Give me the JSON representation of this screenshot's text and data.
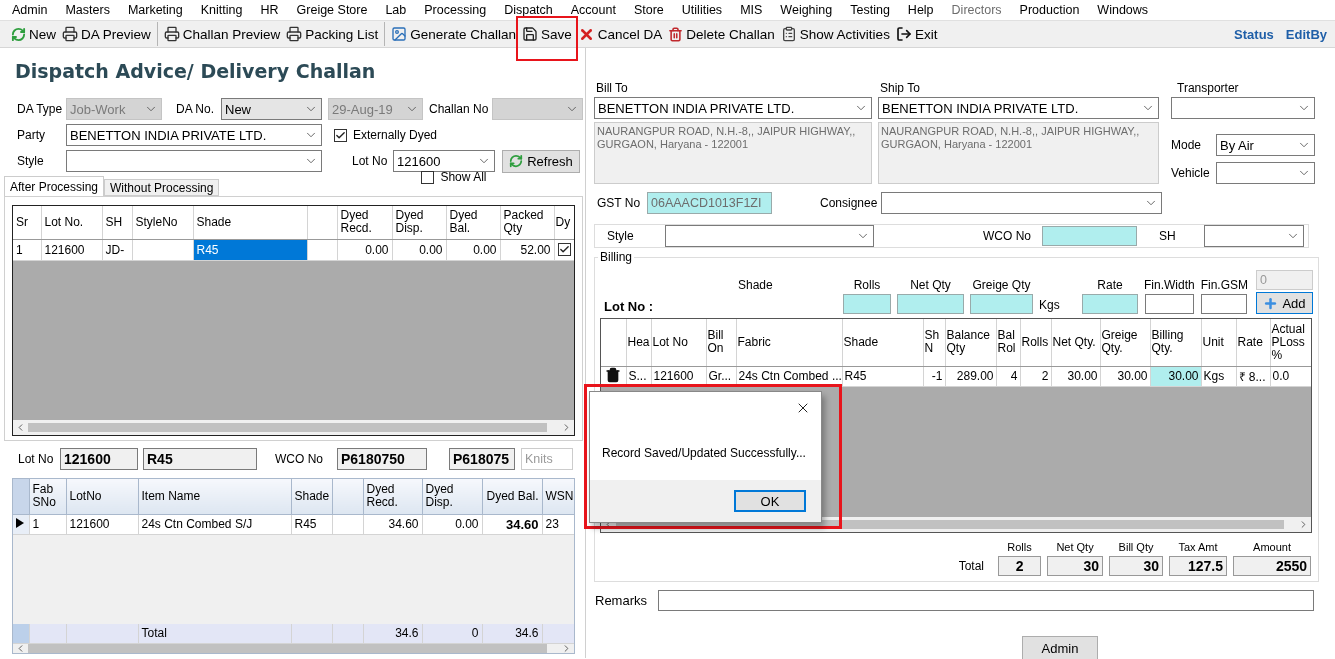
{
  "menu": [
    {
      "label": "Admin",
      "disabled": false
    },
    {
      "label": "Masters",
      "disabled": false
    },
    {
      "label": "Marketing",
      "disabled": false
    },
    {
      "label": "Knitting",
      "disabled": false
    },
    {
      "label": "HR",
      "disabled": false
    },
    {
      "label": "Greige Store",
      "disabled": false
    },
    {
      "label": "Lab",
      "disabled": false
    },
    {
      "label": "Processing",
      "disabled": false
    },
    {
      "label": "Dispatch",
      "disabled": false
    },
    {
      "label": "Account",
      "disabled": false
    },
    {
      "label": "Store",
      "disabled": false
    },
    {
      "label": "Utilities",
      "disabled": false
    },
    {
      "label": "MIS",
      "disabled": false
    },
    {
      "label": "Weighing",
      "disabled": false
    },
    {
      "label": "Testing",
      "disabled": false
    },
    {
      "label": "Help",
      "disabled": false
    },
    {
      "label": "Directors",
      "disabled": true
    },
    {
      "label": "Production",
      "disabled": false
    },
    {
      "label": "Windows",
      "disabled": false
    }
  ],
  "toolbar": {
    "groups": [
      [
        {
          "label": "New",
          "highlighted": false
        },
        {
          "label": "DA Preview",
          "highlighted": false
        }
      ],
      [
        {
          "label": "Challan Preview",
          "highlighted": false
        },
        {
          "label": "Packing List",
          "highlighted": false
        }
      ],
      [
        {
          "label": "Generate Challan",
          "highlighted": false
        },
        {
          "label": "Save",
          "highlighted": true
        },
        {
          "label": "Cancel DA",
          "highlighted": false
        },
        {
          "label": "Delete Challan",
          "highlighted": false
        },
        {
          "label": "Show Activities",
          "highlighted": false
        },
        {
          "label": "Exit",
          "highlighted": false
        }
      ]
    ],
    "links": [
      "Status",
      "EditBy"
    ]
  },
  "title": "Dispatch Advice/ Delivery Challan",
  "header_form": {
    "da_type": {
      "label": "DA Type",
      "value": "Job-Work",
      "disabled": true
    },
    "da_no": {
      "label": "DA No.",
      "value": "New",
      "disabled": false
    },
    "date": {
      "value": "29-Aug-19",
      "disabled": true
    },
    "challan_no": {
      "label": "Challan No",
      "disabled": true
    },
    "party": {
      "label": "Party",
      "value": "BENETTON INDIA PRIVATE LTD."
    },
    "externally_dyed": {
      "label": "Externally Dyed",
      "checked": true
    },
    "style": {
      "label": "Style"
    },
    "lot_no": {
      "label": "Lot No",
      "value": "121600"
    },
    "refresh_button": "Refresh",
    "show_all": {
      "label": "Show All",
      "checked": false
    }
  },
  "tabs": [
    {
      "label": "After Processing",
      "selected": true
    },
    {
      "label": "Without Processing",
      "selected": false
    }
  ],
  "processing_grid": {
    "columns": [
      "Sr",
      "Lot No.",
      "SH",
      "StyleNo",
      "Shade",
      "Dyed Recd.",
      "Dyed Disp.",
      "Dyed Bal.",
      "Packed Qty",
      "Dy"
    ],
    "rows": [
      {
        "checked": true,
        "cells": [
          {
            "text": "1",
            "selected": false
          },
          {
            "text": "121600",
            "selected": false
          },
          {
            "text": "JD-",
            "selected": false
          },
          {
            "text": "",
            "selected": false
          },
          {
            "text": "R45",
            "selected": true
          },
          {
            "text": "0.00",
            "selected": false
          },
          {
            "text": "0.00",
            "selected": false
          },
          {
            "text": "0.00",
            "selected": false
          },
          {
            "text": "52.00",
            "selected": false
          }
        ]
      }
    ]
  },
  "lot_info": {
    "lot_label": "Lot No",
    "lot_no": "121600",
    "shade": "R45",
    "wco_label": "WCO No",
    "wco_no": "P6180750",
    "wco_no_2": "P618075",
    "unit_placeholder": "Knits"
  },
  "fabric_grid": {
    "columns": [
      "Fab SNo",
      "LotNo",
      "Item Name",
      "Shade",
      "Dyed Recd.",
      "Dyed Disp.",
      "Dyed Bal.",
      "WSN"
    ],
    "rows": [
      {
        "selected": true,
        "cells": [
          "1",
          "121600",
          "24s Ctn Combed S/J",
          "R45",
          "34.60",
          "0.00",
          "34.60",
          "23"
        ]
      }
    ],
    "total": {
      "label": "Total",
      "dyed_recd": "34.6",
      "dyed_disp": "0",
      "dyed_bal": "34.6"
    }
  },
  "bill_to": {
    "label": "Bill To",
    "value": "BENETTON INDIA PRIVATE LTD.",
    "address_lines": [
      "NAURANGPUR ROAD, N.H.-8,, JAIPUR HIGHWAY,,",
      "GURGAON, Haryana - 122001"
    ]
  },
  "ship_to": {
    "label": "Ship To",
    "value": "BENETTON INDIA PRIVATE LTD.",
    "address_lines": [
      "NAURANGPUR ROAD, N.H.-8,, JAIPUR HIGHWAY,,",
      "GURGAON, Haryana - 122001"
    ]
  },
  "transporter": {
    "label": "Transporter"
  },
  "mode": {
    "label": "Mode",
    "value": "By Air"
  },
  "vehicle": {
    "label": "Vehicle"
  },
  "gst": {
    "label": "GST No",
    "value": "06AAACD1013F1ZI"
  },
  "consignee": {
    "label": "Consignee"
  },
  "item_filter": {
    "style_label": "Style",
    "wco_label": "WCO No",
    "sh_label": "SH"
  },
  "billing": {
    "title": "Billing",
    "lot_label": "Lot No :",
    "shade_label": "Shade",
    "unit": "Kgs",
    "counter": "0",
    "add_button": "Add",
    "inputs": [
      {
        "label": "Rolls",
        "highlighted": true
      },
      {
        "label": "Net Qty",
        "highlighted": true
      },
      {
        "label": "Greige Qty",
        "highlighted": true
      },
      {
        "label": "Rate",
        "highlighted": true
      },
      {
        "label": "Fin.Width",
        "highlighted": false
      },
      {
        "label": "Fin.GSM",
        "highlighted": false
      }
    ]
  },
  "billing_grid": {
    "columns": [
      "Hea",
      "Lot No",
      "Bill On",
      "Fabric",
      "Shade",
      "Sh N",
      "Balance Qty",
      "Bal Rol",
      "Rolls",
      "Net Qty.",
      "Greige Qty.",
      "Billing Qty.",
      "Unit",
      "Rate",
      "Actual PLoss %"
    ],
    "rows": [
      {
        "cells": [
          {
            "text": "S...",
            "highlighted": false
          },
          {
            "text": "121600",
            "highlighted": false
          },
          {
            "text": "Gr...",
            "highlighted": false
          },
          {
            "text": "24s Ctn Combed ...",
            "highlighted": false
          },
          {
            "text": "R45",
            "highlighted": false
          },
          {
            "text": "-1",
            "highlighted": false
          },
          {
            "text": "289.00",
            "highlighted": false
          },
          {
            "text": "4",
            "highlighted": false
          },
          {
            "text": "2",
            "highlighted": false
          },
          {
            "text": "30.00",
            "highlighted": false
          },
          {
            "text": "30.00",
            "highlighted": false
          },
          {
            "text": "30.00",
            "highlighted": true
          },
          {
            "text": "Kgs",
            "highlighted": false
          },
          {
            "text": "₹ 8...",
            "highlighted": false
          },
          {
            "text": "0.0",
            "highlighted": false
          }
        ]
      }
    ]
  },
  "totals": {
    "label": "Total",
    "items": [
      {
        "label": "Rolls",
        "value": "2"
      },
      {
        "label": "Net Qty",
        "value": "30"
      },
      {
        "label": "Bill Qty",
        "value": "30"
      },
      {
        "label": "Tax Amt",
        "value": "127.5"
      },
      {
        "label": "Amount",
        "value": "2550"
      }
    ]
  },
  "remarks": {
    "label": "Remarks"
  },
  "admin_button": "Admin",
  "dialog": {
    "message": "Record Saved/Updated Successfully...",
    "button": "OK",
    "highlighted": true
  }
}
